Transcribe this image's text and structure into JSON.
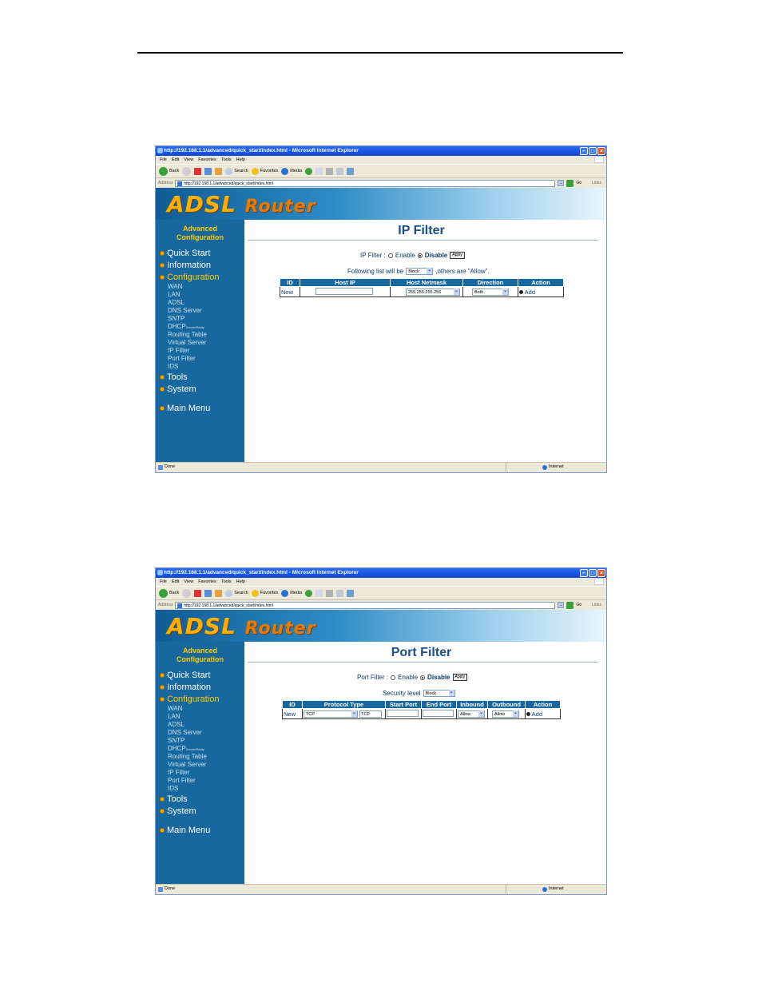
{
  "browser": {
    "title": "http://192.168.1.1/advanced/quick_start/index.html - Microsoft Internet Explorer",
    "menu": [
      "File",
      "Edit",
      "View",
      "Favorites",
      "Tools",
      "Help"
    ],
    "toolbar": {
      "back": "Back",
      "search": "Search",
      "favorites": "Favorites",
      "media": "Media"
    },
    "address_label": "Address",
    "address": "http://192.168.1.1/advanced/quick_start/index.html",
    "go": "Go",
    "links": "Links",
    "status_done": "Done",
    "status_zone": "Internet"
  },
  "sidebar": {
    "advanced": "Advanced",
    "configuration": "Configuration",
    "quick_start": "Quick Start",
    "information": "Information",
    "configuration_menu": "Configuration",
    "sub": [
      "WAN",
      "LAN",
      "ADSL",
      "DNS Server",
      "SNTP",
      "DHCP",
      "Routing Table",
      "Virtual Server",
      "IP Filter",
      "Port Filter",
      "IDS"
    ],
    "dhcp_suffix": "Server/Relay",
    "tools": "Tools",
    "system": "System",
    "main_menu": "Main Menu"
  },
  "logo": {
    "adsl": "ADSL",
    "router": "Router"
  },
  "ip_filter": {
    "title": "IP Filter",
    "label": "IP Filter :",
    "enable": "Enable",
    "disable": "Disable",
    "apply": "Apply",
    "list_prefix": "Following list will be",
    "list_value": "Block",
    "list_suffix": ",others are \"Allow\".",
    "headers": [
      "ID",
      "Host IP",
      "Host Netmask",
      "Direction",
      "Action"
    ],
    "row": {
      "id": "New",
      "netmask": "255.255.255.255",
      "direction": "Both",
      "action": "Add"
    }
  },
  "port_filter": {
    "title": "Port Filter",
    "label": "Port Filter :",
    "enable": "Enable",
    "disable": "Disable",
    "apply": "Apply",
    "security_label": "Security level",
    "security_value": "Block",
    "headers": [
      "ID",
      "Protocol Type",
      "Start Port",
      "End Port",
      "Inbound",
      "Outbound",
      "Action"
    ],
    "row": {
      "id": "New",
      "protocol": "TCP",
      "protocol_text": "TCP",
      "inbound": "Allow",
      "outbound": "Allow",
      "action": "Add"
    }
  }
}
